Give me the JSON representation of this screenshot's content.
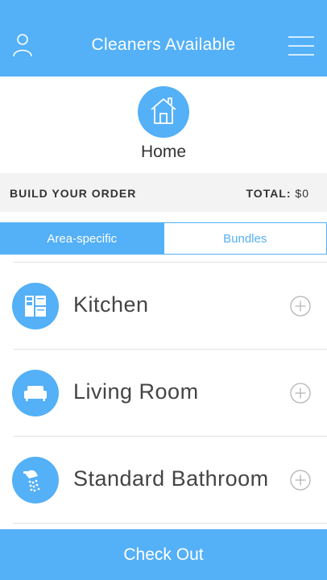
{
  "header": {
    "title": "Cleaners Available",
    "left_icon": "user-icon",
    "right_icon": "menu-icon"
  },
  "home": {
    "icon": "house-icon",
    "label": "Home"
  },
  "order_bar": {
    "label": "BUILD YOUR ORDER",
    "total_label": "TOTAL:",
    "total_value": "$0"
  },
  "tabs": [
    {
      "label": "Area-specific",
      "active": true
    },
    {
      "label": "Bundles",
      "active": false
    }
  ],
  "rooms": [
    {
      "label": "Kitchen",
      "icon": "kitchen-icon",
      "action_icon": "add-circle-icon"
    },
    {
      "label": "Living Room",
      "icon": "sofa-icon",
      "action_icon": "add-circle-icon"
    },
    {
      "label": "Standard Bathroom",
      "icon": "shower-icon",
      "action_icon": "add-circle-icon"
    }
  ],
  "checkout": {
    "label": "Check Out"
  },
  "colors": {
    "accent": "#54b0f7",
    "bar_background": "#f3f3f3",
    "text": "#444444",
    "divider": "#e2e2e2"
  }
}
